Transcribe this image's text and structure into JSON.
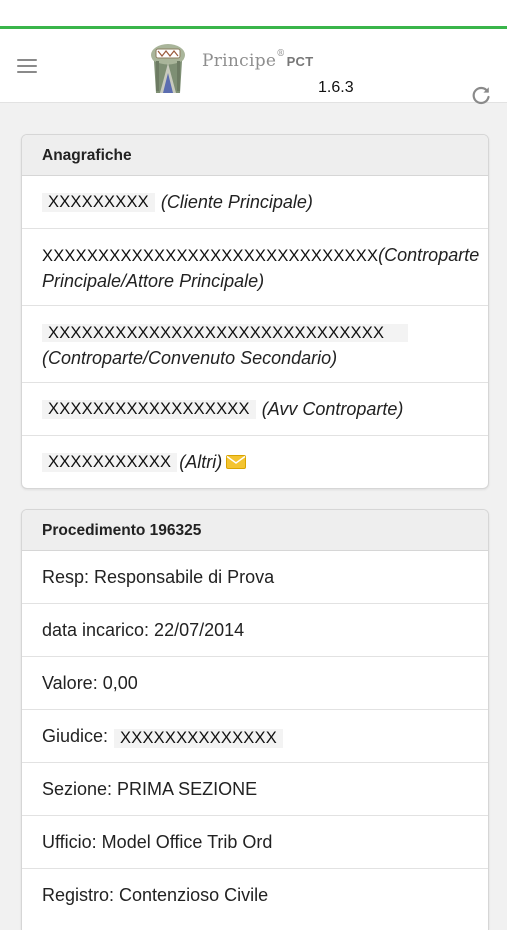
{
  "app": {
    "brand": "Principe",
    "brand_reg": "®",
    "brand_sub": "PCT",
    "version": "1.6.3",
    "accent_color": "#39b54a"
  },
  "anagrafiche": {
    "title": "Anagrafiche",
    "items": [
      {
        "name": "XXXXXXXXX",
        "role": "(Cliente Principale)"
      },
      {
        "name": "XXXXXXXXXXXXXXXXXXXXXXXXXXXXXX",
        "role": "(Controparte Principale/Attore Principale)"
      },
      {
        "name": "XXXXXXXXXXXXXXXXXXXXXXXXXXXXXX",
        "role": "(Controparte/Convenuto Secondario)"
      },
      {
        "name": "XXXXXXXXXXXXXXXXXX",
        "role": "(Avv Controparte)"
      },
      {
        "name": "XXXXXXXXXXX",
        "role": "(Altri)",
        "icon": "envelope-icon"
      }
    ]
  },
  "procedimento": {
    "title": "Procedimento 196325",
    "resp": "Resp: Responsabile di Prova",
    "data_incarico": "data incarico: 22/07/2014",
    "valore": "Valore: 0,00",
    "giudice_label": "Giudice:",
    "giudice_value": "XXXXXXXXXXXXXX",
    "sezione": "Sezione: PRIMA SEZIONE",
    "ufficio": "Ufficio: Model Office Trib Ord",
    "registro": "Registro: Contenzioso Civile"
  }
}
